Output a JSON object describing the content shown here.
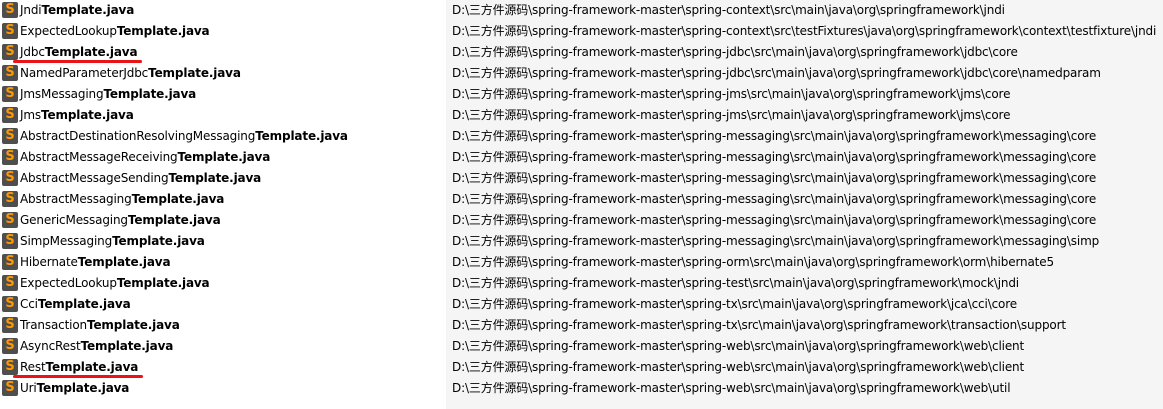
{
  "results": [
    {
      "prefix": "Jndi",
      "match": "Template.java",
      "path": "D:\\三方件源码\\spring-framework-master\\spring-context\\src\\main\\java\\org\\springframework\\jndi"
    },
    {
      "prefix": "ExpectedLookup",
      "match": "Template.java",
      "path": "D:\\三方件源码\\spring-framework-master\\spring-context\\src\\testFixtures\\java\\org\\springframework\\context\\testfixture\\jndi"
    },
    {
      "prefix": "Jdbc",
      "match": "Template.java",
      "path": "D:\\三方件源码\\spring-framework-master\\spring-jdbc\\src\\main\\java\\org\\springframework\\jdbc\\core"
    },
    {
      "prefix": "NamedParameterJdbc",
      "match": "Template.java",
      "path": "D:\\三方件源码\\spring-framework-master\\spring-jdbc\\src\\main\\java\\org\\springframework\\jdbc\\core\\namedparam"
    },
    {
      "prefix": "JmsMessaging",
      "match": "Template.java",
      "path": "D:\\三方件源码\\spring-framework-master\\spring-jms\\src\\main\\java\\org\\springframework\\jms\\core"
    },
    {
      "prefix": "Jms",
      "match": "Template.java",
      "path": "D:\\三方件源码\\spring-framework-master\\spring-jms\\src\\main\\java\\org\\springframework\\jms\\core"
    },
    {
      "prefix": "AbstractDestinationResolvingMessaging",
      "match": "Template.java",
      "path": "D:\\三方件源码\\spring-framework-master\\spring-messaging\\src\\main\\java\\org\\springframework\\messaging\\core"
    },
    {
      "prefix": "AbstractMessageReceiving",
      "match": "Template.java",
      "path": "D:\\三方件源码\\spring-framework-master\\spring-messaging\\src\\main\\java\\org\\springframework\\messaging\\core"
    },
    {
      "prefix": "AbstractMessageSending",
      "match": "Template.java",
      "path": "D:\\三方件源码\\spring-framework-master\\spring-messaging\\src\\main\\java\\org\\springframework\\messaging\\core"
    },
    {
      "prefix": "AbstractMessaging",
      "match": "Template.java",
      "path": "D:\\三方件源码\\spring-framework-master\\spring-messaging\\src\\main\\java\\org\\springframework\\messaging\\core"
    },
    {
      "prefix": "GenericMessaging",
      "match": "Template.java",
      "path": "D:\\三方件源码\\spring-framework-master\\spring-messaging\\src\\main\\java\\org\\springframework\\messaging\\core"
    },
    {
      "prefix": "SimpMessaging",
      "match": "Template.java",
      "path": "D:\\三方件源码\\spring-framework-master\\spring-messaging\\src\\main\\java\\org\\springframework\\messaging\\simp"
    },
    {
      "prefix": "Hibernate",
      "match": "Template.java",
      "path": "D:\\三方件源码\\spring-framework-master\\spring-orm\\src\\main\\java\\org\\springframework\\orm\\hibernate5"
    },
    {
      "prefix": "ExpectedLookup",
      "match": "Template.java",
      "path": "D:\\三方件源码\\spring-framework-master\\spring-test\\src\\main\\java\\org\\springframework\\mock\\jndi"
    },
    {
      "prefix": "Cci",
      "match": "Template.java",
      "path": "D:\\三方件源码\\spring-framework-master\\spring-tx\\src\\main\\java\\org\\springframework\\jca\\cci\\core"
    },
    {
      "prefix": "Transaction",
      "match": "Template.java",
      "path": "D:\\三方件源码\\spring-framework-master\\spring-tx\\src\\main\\java\\org\\springframework\\transaction\\support"
    },
    {
      "prefix": "AsyncRest",
      "match": "Template.java",
      "path": "D:\\三方件源码\\spring-framework-master\\spring-web\\src\\main\\java\\org\\springframework\\web\\client"
    },
    {
      "prefix": "Rest",
      "match": "Template.java",
      "path": "D:\\三方件源码\\spring-framework-master\\spring-web\\src\\main\\java\\org\\springframework\\web\\client"
    },
    {
      "prefix": "Uri",
      "match": "Template.java",
      "path": "D:\\三方件源码\\spring-framework-master\\spring-web\\src\\main\\java\\org\\springframework\\web\\util"
    }
  ],
  "icon": {
    "name": "sublime-text-file-icon",
    "glyph": "S",
    "bg_color": "#4e4e4e",
    "fg_color": "#ff9800"
  },
  "highlight": {
    "color": "#e8141a",
    "rows": [
      2,
      17
    ]
  }
}
